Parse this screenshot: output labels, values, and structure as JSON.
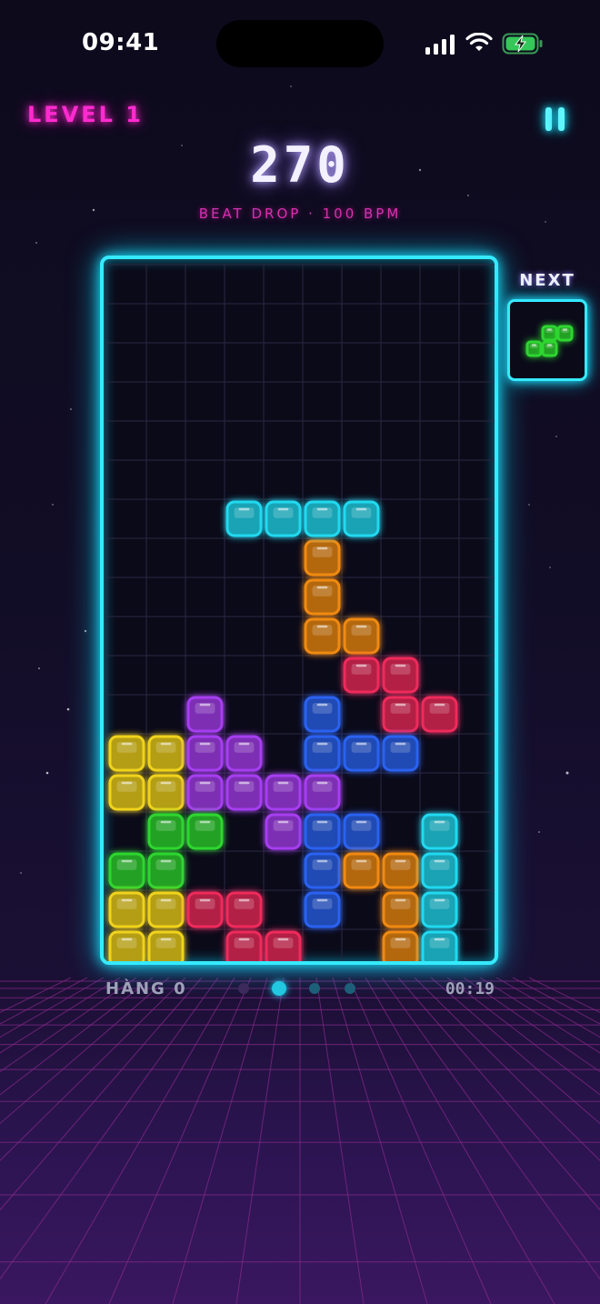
{
  "status_bar": {
    "time": "09:41"
  },
  "hud": {
    "level": "LEVEL 1",
    "score": "270",
    "subtitle": "BEAT DROP · 100 BPM",
    "next_label": "NEXT",
    "lines": "HÀNG 0",
    "timer": "00:19"
  },
  "colors": {
    "cyan": "#21d9f0",
    "orange": "#f08a12",
    "red": "#ee2a5c",
    "purple": "#a63ef0",
    "blue": "#2a62f0",
    "yellow": "#f0d31c",
    "green": "#2ed630",
    "board_border": "#35eaff",
    "level_pink": "#ff2bd0"
  },
  "grid": {
    "cols": 10,
    "rows": 18
  },
  "falling_piece": {
    "color": "cyan",
    "cells": [
      [
        3,
        6
      ],
      [
        4,
        6
      ],
      [
        5,
        6
      ],
      [
        6,
        6
      ]
    ]
  },
  "board_cells": [
    [
      5,
      7,
      "orange"
    ],
    [
      5,
      8,
      "orange"
    ],
    [
      5,
      9,
      "orange"
    ],
    [
      6,
      9,
      "orange"
    ],
    [
      6,
      10,
      "red"
    ],
    [
      7,
      10,
      "red"
    ],
    [
      7,
      11,
      "red"
    ],
    [
      8,
      11,
      "red"
    ],
    [
      2,
      11,
      "purple"
    ],
    [
      5,
      11,
      "blue"
    ],
    [
      0,
      12,
      "yellow"
    ],
    [
      1,
      12,
      "yellow"
    ],
    [
      2,
      12,
      "purple"
    ],
    [
      3,
      12,
      "purple"
    ],
    [
      5,
      12,
      "blue"
    ],
    [
      6,
      12,
      "blue"
    ],
    [
      7,
      12,
      "blue"
    ],
    [
      0,
      13,
      "yellow"
    ],
    [
      1,
      13,
      "yellow"
    ],
    [
      2,
      13,
      "purple"
    ],
    [
      3,
      13,
      "purple"
    ],
    [
      4,
      13,
      "purple"
    ],
    [
      5,
      13,
      "purple"
    ],
    [
      1,
      14,
      "green"
    ],
    [
      2,
      14,
      "green"
    ],
    [
      4,
      14,
      "purple"
    ],
    [
      5,
      14,
      "blue"
    ],
    [
      6,
      14,
      "blue"
    ],
    [
      8,
      14,
      "cyan"
    ],
    [
      0,
      15,
      "green"
    ],
    [
      1,
      15,
      "green"
    ],
    [
      5,
      15,
      "blue"
    ],
    [
      6,
      15,
      "orange"
    ],
    [
      7,
      15,
      "orange"
    ],
    [
      8,
      15,
      "cyan"
    ],
    [
      0,
      16,
      "yellow"
    ],
    [
      1,
      16,
      "yellow"
    ],
    [
      2,
      16,
      "red"
    ],
    [
      3,
      16,
      "red"
    ],
    [
      5,
      16,
      "blue"
    ],
    [
      7,
      16,
      "orange"
    ],
    [
      8,
      16,
      "cyan"
    ],
    [
      0,
      17,
      "yellow"
    ],
    [
      1,
      17,
      "yellow"
    ],
    [
      3,
      17,
      "red"
    ],
    [
      4,
      17,
      "red"
    ],
    [
      7,
      17,
      "orange"
    ],
    [
      8,
      17,
      "cyan"
    ]
  ],
  "next_piece": {
    "color": "green",
    "cells": [
      [
        1,
        0
      ],
      [
        2,
        0
      ],
      [
        0,
        1
      ],
      [
        1,
        1
      ]
    ]
  },
  "beat_dots": {
    "count": 4,
    "active": 1
  }
}
